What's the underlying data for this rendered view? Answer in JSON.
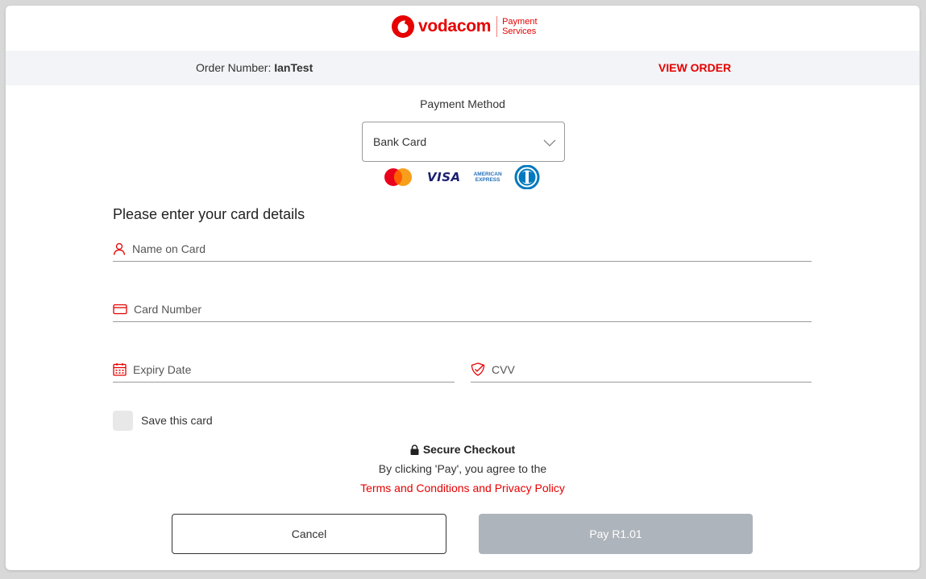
{
  "brand": {
    "name": "vodacom",
    "sub_line1": "Payment",
    "sub_line2": "Services",
    "color": "#e60000"
  },
  "order": {
    "label": "Order Number:",
    "number": "IanTest",
    "view_label": "VIEW ORDER"
  },
  "payment_method": {
    "label": "Payment Method",
    "selected": "Bank Card"
  },
  "card_brands": {
    "visa": "VISA",
    "amex_line1": "AMERICAN",
    "amex_line2": "EXPRESS"
  },
  "form": {
    "title": "Please enter your card details",
    "name_placeholder": "Name on Card",
    "number_placeholder": "Card Number",
    "expiry_placeholder": "Expiry Date",
    "cvv_placeholder": "CVV",
    "save_label": "Save this card"
  },
  "footer": {
    "secure": "Secure Checkout",
    "agree": "By clicking 'Pay', you agree to the",
    "terms": "Terms and Conditions and Privacy Policy"
  },
  "actions": {
    "cancel": "Cancel",
    "pay": "Pay R1.01"
  },
  "icons": {
    "person": "person-icon",
    "card": "credit-card-icon",
    "calendar": "calendar-icon",
    "cvv": "shield-check-icon",
    "lock": "lock-icon",
    "chevron": "chevron-down-icon"
  },
  "colors": {
    "accent": "#e60000",
    "pay_disabled": "#aeb4bb",
    "order_bar": "#f2f4f7"
  }
}
